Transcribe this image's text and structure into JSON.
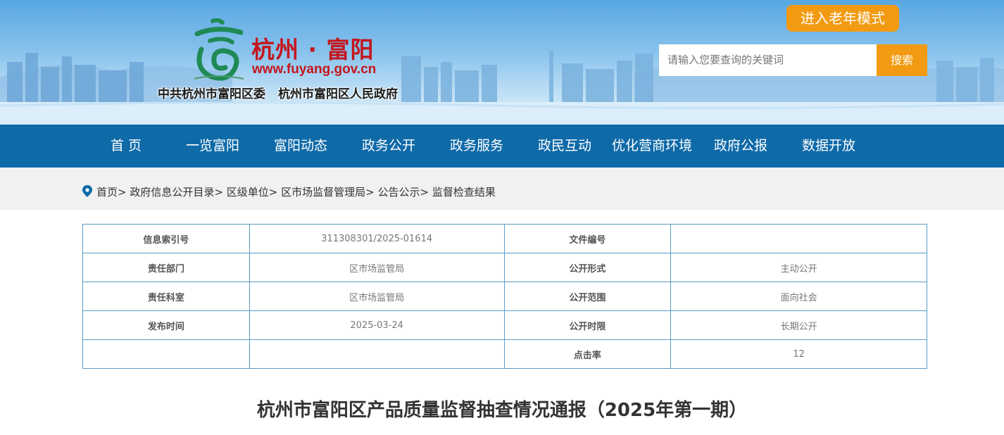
{
  "header": {
    "site_name": "杭州 · 富阳",
    "site_url": "www.fuyang.gov.cn",
    "org_party": "中共杭州市富阳区委",
    "org_gov": "杭州市富阳区人民政府",
    "elder_mode_label": "进入老年模式",
    "search": {
      "placeholder": "请输入您要查询的关键词",
      "button_label": "搜索"
    },
    "accent_color": "#f29a12"
  },
  "nav": {
    "color": "#0f6aa8",
    "items": [
      {
        "label": "首 页"
      },
      {
        "label": "一览富阳"
      },
      {
        "label": "富阳动态"
      },
      {
        "label": "政务公开"
      },
      {
        "label": "政务服务"
      },
      {
        "label": "政民互动"
      },
      {
        "label": "优化营商环境"
      },
      {
        "label": "政府公报"
      },
      {
        "label": "数据开放"
      }
    ]
  },
  "breadcrumb": {
    "separator": ">",
    "items": [
      "首页",
      "政府信息公开目录",
      "区级单位",
      "区市场监督管理局",
      "公告公示",
      "监督检查结果"
    ]
  },
  "meta": {
    "rows": [
      {
        "k1": "信息索引号",
        "v1": "311308301/2025-01614",
        "k2": "文件编号",
        "v2": ""
      },
      {
        "k1": "责任部门",
        "v1": "区市场监管局",
        "k2": "公开形式",
        "v2": "主动公开"
      },
      {
        "k1": "责任科室",
        "v1": "区市场监管局",
        "k2": "公开范围",
        "v2": "面向社会"
      },
      {
        "k1": "发布时间",
        "v1": "2025-03-24",
        "k2": "公开时限",
        "v2": "长期公开"
      },
      {
        "k1": "",
        "v1": "",
        "k2": "点击率",
        "v2": "12"
      }
    ]
  },
  "document": {
    "title": "杭州市富阳区产品质量监督抽查情况通报（2025年第一期）"
  }
}
